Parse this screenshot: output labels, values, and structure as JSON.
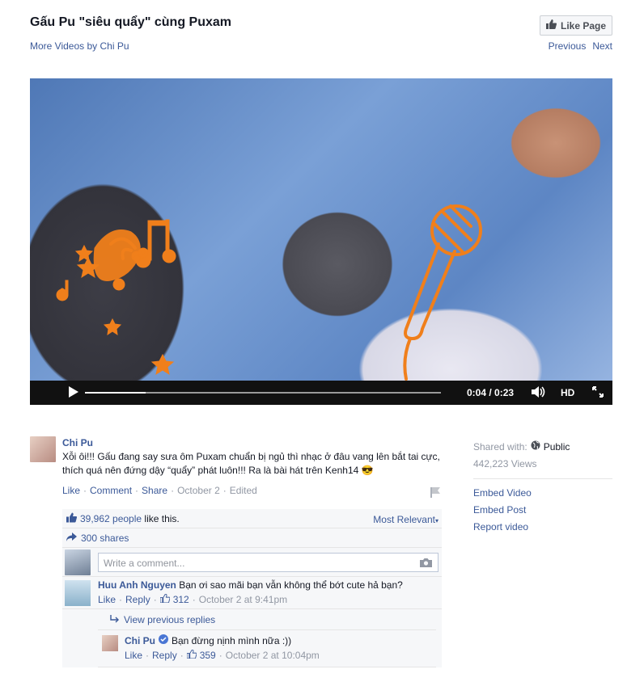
{
  "header": {
    "title": "Gấu Pu \"siêu quẩy\" cùng Puxam",
    "more_videos": "More Videos by Chi Pu",
    "like_page": "Like Page",
    "previous": "Previous",
    "next": "Next"
  },
  "video": {
    "time": "0:04 / 0:23",
    "hd": "HD",
    "progress": 0.17
  },
  "post": {
    "author": "Chi Pu",
    "text": "Xỗi ôi!!! Gấu đang say sưa ôm Puxam chuẩn bị ngủ thì nhạc ở đâu vang lên bắt tai cực, thích quá nên đứng dậy “quẩy” phát luôn!!! Ra là bài hát trên Kenh14 😎",
    "actions": {
      "like": "Like",
      "comment": "Comment",
      "share": "Share",
      "date": "October 2",
      "edited": "Edited"
    }
  },
  "ufi": {
    "likes_count": "39,962 people",
    "likes_suffix": " like this.",
    "most_relevant": "Most Relevant",
    "shares": "300 shares",
    "comment_placeholder": "Write a comment..."
  },
  "comments": [
    {
      "author": "Huu Anh Nguyen",
      "text": "Bạn ơi sao mãi bạn vẫn không thể bớt cute hả bạn?",
      "like": "Like",
      "reply": "Reply",
      "likes": "312",
      "time": "October 2 at 9:41pm"
    }
  ],
  "replies": {
    "view_previous": "View previous replies",
    "items": [
      {
        "author": "Chi Pu",
        "text": "Bạn đừng nịnh mình nữa :))",
        "like": "Like",
        "reply": "Reply",
        "likes": "359",
        "time": "October 2 at 10:04pm"
      }
    ]
  },
  "side": {
    "shared_with_label": "Shared with:",
    "audience": "Public",
    "views": "442,223 Views",
    "embed_video": "Embed Video",
    "embed_post": "Embed Post",
    "report_video": "Report video"
  },
  "colors": {
    "link": "#3b5998",
    "meta": "#9197a3",
    "ufi_bg": "#f6f7f9",
    "verified": "#4a76d4",
    "sticker_orange": "#f07f1b"
  }
}
